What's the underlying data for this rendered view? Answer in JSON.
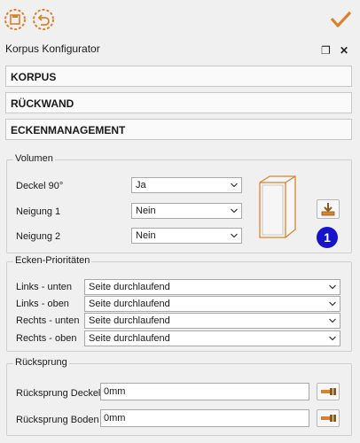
{
  "toolbar": {
    "save_icon": "save-icon",
    "undo_icon": "undo-icon",
    "confirm_icon": "checkmark-icon"
  },
  "panel": {
    "title": "Korpus Konfigurator",
    "restore_icon": "❐",
    "close_icon": "✕"
  },
  "sections": [
    "KORPUS",
    "RÜCKWAND",
    "ECKENMANAGEMENT"
  ],
  "volumen": {
    "title": "Volumen",
    "rows": [
      {
        "label": "Deckel 90°",
        "value": "Ja"
      },
      {
        "label": "Neigung 1",
        "value": "Nein"
      },
      {
        "label": "Neigung 2",
        "value": "Nein"
      }
    ],
    "badge": "1"
  },
  "ecken": {
    "title": "Ecken-Prioritäten",
    "rows": [
      {
        "label": "Links - unten",
        "value": "Seite durchlaufend"
      },
      {
        "label": "Links - oben",
        "value": "Seite durchlaufend"
      },
      {
        "label": "Rechts - unten",
        "value": "Seite durchlaufend"
      },
      {
        "label": "Rechts - oben",
        "value": "Seite durchlaufend"
      }
    ]
  },
  "ruecksprung": {
    "title": "Rücksprung",
    "rows": [
      {
        "label": "Rücksprung Deckel",
        "value": "0mm"
      },
      {
        "label": "Rücksprung Boden",
        "value": "0mm"
      }
    ]
  },
  "colors": {
    "accent": "#d9822b",
    "badge": "#1414c8"
  }
}
